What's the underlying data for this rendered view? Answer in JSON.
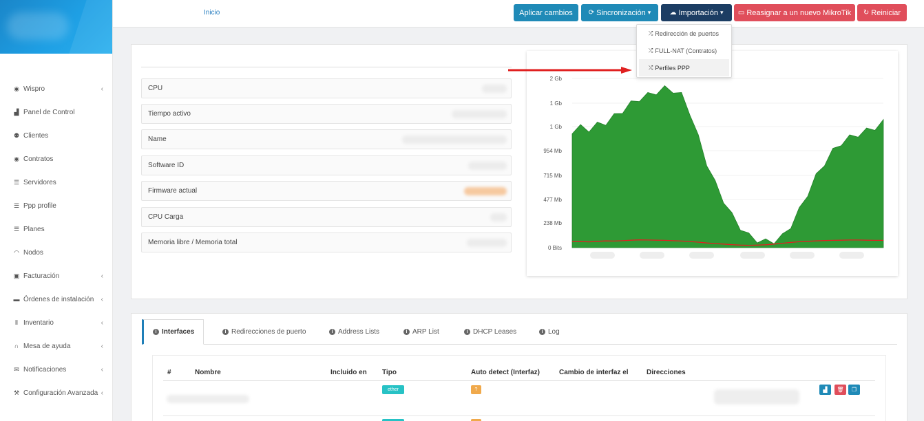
{
  "breadcrumb": {
    "home": "Inicio"
  },
  "toolbar": {
    "apply": "Aplicar cambios",
    "sync": "Sincronización",
    "import": "Importación",
    "reassign": "Reasignar a un nuevo MikroTik",
    "restart": "Reiniciar"
  },
  "import_menu": {
    "items": [
      "Redirección de puertos",
      "FULL-NAT (Contratos)",
      "Perfiles PPP"
    ],
    "active_index": 2
  },
  "sidebar": {
    "items": [
      {
        "label": "Wispro",
        "icon": "eye-icon",
        "has_children": true
      },
      {
        "label": "Panel de Control",
        "icon": "chart-icon",
        "has_children": false
      },
      {
        "label": "Clientes",
        "icon": "users-icon",
        "has_children": false
      },
      {
        "label": "Contratos",
        "icon": "eye-icon",
        "has_children": false
      },
      {
        "label": "Servidores",
        "icon": "server-icon",
        "has_children": false
      },
      {
        "label": "Ppp profile",
        "icon": "server-icon",
        "has_children": false
      },
      {
        "label": "Planes",
        "icon": "server-icon",
        "has_children": false
      },
      {
        "label": "Nodos",
        "icon": "wifi-icon",
        "has_children": false
      },
      {
        "label": "Facturación",
        "icon": "money-icon",
        "has_children": true
      },
      {
        "label": "Órdenes de instalación",
        "icon": "truck-icon",
        "has_children": true
      },
      {
        "label": "Inventario",
        "icon": "barcode-icon",
        "has_children": true
      },
      {
        "label": "Mesa de ayuda",
        "icon": "headset-icon",
        "has_children": true
      },
      {
        "label": "Notificaciones",
        "icon": "envelope-icon",
        "has_children": true
      },
      {
        "label": "Configuración Avanzada",
        "icon": "wrench-icon",
        "has_children": true
      }
    ]
  },
  "device_info": {
    "rows": [
      "CPU",
      "Tiempo activo",
      "Name",
      "Software ID",
      "Firmware actual",
      "CPU Carga",
      "Memoria libre / Memoria total"
    ]
  },
  "chart_data": {
    "type": "area",
    "y_tick_labels": [
      "2 Gb",
      "1 Gb",
      "1 Gb",
      "954 Mb",
      "715 Mb",
      "477 Mb",
      "238 Mb",
      "0 Bits"
    ],
    "ylim": [
      0,
      2000
    ],
    "series": [
      {
        "values": [
          1380,
          1420,
          1400,
          1450,
          1480,
          1550,
          1620,
          1700,
          1760,
          1800,
          1840,
          1880,
          1860,
          1800,
          1600,
          1300,
          1000,
          760,
          560,
          380,
          240,
          140,
          90,
          70,
          80,
          130,
          260,
          440,
          640,
          840,
          1000,
          1140,
          1240,
          1300,
          1340,
          1380,
          1420,
          1480
        ]
      },
      {
        "values": [
          70,
          72,
          68,
          75,
          80,
          78,
          82,
          88,
          92,
          90,
          88,
          86,
          82,
          78,
          72,
          65,
          55,
          48,
          42,
          35,
          30,
          28,
          30,
          34,
          42,
          52,
          62,
          70,
          75,
          80,
          84,
          86,
          88,
          90,
          90,
          88,
          86,
          86
        ]
      }
    ],
    "colors": {
      "area": "#2e9a35",
      "line": "#e02020"
    }
  },
  "tabs": {
    "items": [
      "Interfaces",
      "Redirecciones de puerto",
      "Address Lists",
      "ARP List",
      "DHCP Leases",
      "Log"
    ],
    "active_index": 0
  },
  "interfaces_table": {
    "headers": [
      "#",
      "Nombre",
      "Incluido en",
      "Tipo",
      "Auto detect (Interfaz)",
      "Cambio de interfaz el",
      "Direcciones"
    ],
    "rows": [
      {
        "type": "ether",
        "auto_detect": "?"
      },
      {
        "type": "",
        "auto_detect": ""
      }
    ]
  }
}
